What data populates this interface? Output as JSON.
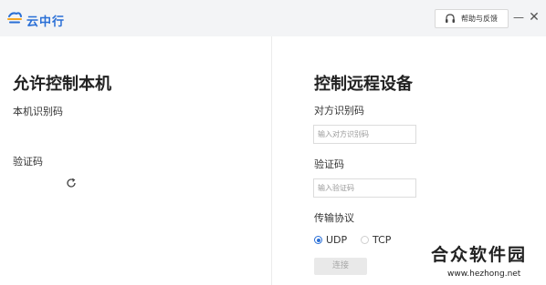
{
  "titlebar": {
    "app_name": "云中行",
    "logo_icon": "cloud-logo-icon",
    "feedback_label": "帮助与反馈",
    "feedback_icon": "headset-icon",
    "minimize_glyph": "—",
    "close_glyph": "✕",
    "accent_color": "#2a6fd6"
  },
  "left_panel": {
    "title": "允许控制本机",
    "machine_code_label": "本机识别码",
    "verification_code_label": "验证码",
    "loading_icon": "refresh-spinner-icon"
  },
  "right_panel": {
    "title": "控制远程设备",
    "peer_code_label": "对方识别码",
    "peer_code_placeholder": "输入对方识别码",
    "peer_code_value": "",
    "verification_code_label": "验证码",
    "verification_code_placeholder": "输入验证码",
    "verification_code_value": "",
    "protocol_label": "传输协议",
    "protocol_options": [
      "UDP",
      "TCP"
    ],
    "protocol_selected": "UDP",
    "connect_label": "连接"
  },
  "watermark": {
    "title": "合众软件园",
    "url": "www.hezhong.net"
  }
}
